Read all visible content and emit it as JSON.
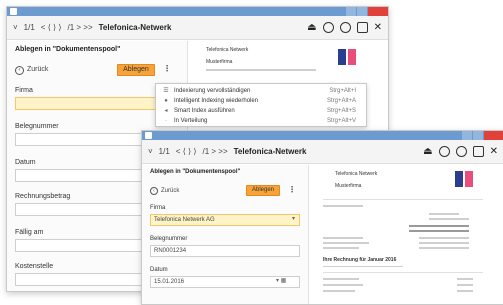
{
  "colors": {
    "titlebar": "#6c9bd1",
    "accent_button": "#f7a33a",
    "highlight_field": "#fff3c7",
    "close": "#e0423b",
    "logo_blue": "#2a3d8f",
    "logo_pink": "#ea4d7c"
  },
  "icons": [
    "app-icon",
    "chevron-down-icon",
    "back-icon",
    "upload-icon",
    "scan-icon",
    "settings-icon",
    "window-icon",
    "close-icon",
    "calendar-icon",
    "more-icon"
  ],
  "back": {
    "toolbar": {
      "chevron": "˅",
      "prev": "‹",
      "page": "1/1",
      "next": "›",
      "nav": "< ⟨ ⟩ ⟩",
      "window": "/1 > >>",
      "title": "Telefonica-Netwerk",
      "upload": "⏏",
      "close": "✕"
    },
    "heading": "Ablegen in \"Dokumentenspool\"",
    "back_label": "Zurück",
    "submit_label": "Ablegen",
    "more": "⋮",
    "fields": [
      {
        "label": "Firma",
        "value": ""
      },
      {
        "label": "Belegnummer",
        "value": ""
      },
      {
        "label": "Datum",
        "value": ""
      },
      {
        "label": "Rechnungsbetrag",
        "value": ""
      },
      {
        "label": "Fällig am",
        "value": ""
      },
      {
        "label": "Kostenstelle",
        "value": ""
      }
    ],
    "menu": [
      {
        "label": "Indexierung vervollständigen",
        "shortcut": "Strg+Alt+I"
      },
      {
        "label": "Intelligent Indexing wiederholen",
        "shortcut": "Strg+Alt+A"
      },
      {
        "label": "Smart Index ausführen",
        "shortcut": "Strg+Alt+S"
      },
      {
        "label": "In Verteilung",
        "shortcut": "Strg+Alt+V"
      }
    ],
    "doc_sender": "Telefonica Netwerk",
    "doc_recipient": "Musterfirma"
  },
  "front": {
    "toolbar": {
      "chevron": "˅",
      "page": "1/1",
      "nav": "< ⟨ ⟩ ⟩",
      "window": "/1 > >>",
      "title": "Telefonica-Netwerk",
      "upload": "⏏",
      "close": "✕"
    },
    "heading": "Ablegen in \"Dokumentenspool\"",
    "back_label": "Zurück",
    "submit_label": "Ablegen",
    "more": "⋮",
    "fields": [
      {
        "label": "Firma",
        "value": "Telefonica Netwerk AG"
      },
      {
        "label": "Belegnummer",
        "value": "RN0001234"
      },
      {
        "label": "Datum",
        "value": "15.01.2016"
      }
    ],
    "doc_sender": "Telefonica Netwerk",
    "doc_recipient": "Musterfirma",
    "doc_heading": "Ihre Rechnung für Januar 2016"
  }
}
